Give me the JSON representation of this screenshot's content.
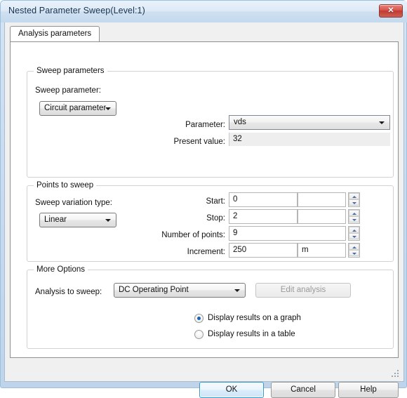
{
  "window": {
    "title": "Nested Parameter Sweep(Level:1)",
    "close_label": "✕",
    "close_icon": "close-icon",
    "accent_color": "#2f9bd4",
    "titlebar_color": "#cfe0f0"
  },
  "tabs": [
    {
      "label": "Analysis parameters",
      "selected": true
    }
  ],
  "sweep_parameters": {
    "group_title": "Sweep parameters",
    "sweep_parameter_label": "Sweep parameter:",
    "sweep_parameter_value": "Circuit parameter",
    "parameter_label": "Parameter:",
    "parameter_value": "vds",
    "present_value_label": "Present value:",
    "present_value": "32"
  },
  "points_to_sweep": {
    "group_title": "Points to sweep",
    "variation_type_label": "Sweep variation type:",
    "variation_type_value": "Linear",
    "rows": [
      {
        "label": "Start:",
        "value": "0",
        "unit": ""
      },
      {
        "label": "Stop:",
        "value": "2",
        "unit": ""
      },
      {
        "label": "Number of points:",
        "value": "9",
        "unit": null
      },
      {
        "label": "Increment:",
        "value": "250",
        "unit": "m"
      }
    ]
  },
  "more_options": {
    "group_title": "More Options",
    "analysis_to_sweep_label": "Analysis to sweep:",
    "analysis_to_sweep_value": "DC Operating Point",
    "edit_analysis_label": "Edit analysis",
    "edit_analysis_enabled": false,
    "radios": [
      {
        "label": "Display results on a graph",
        "checked": true
      },
      {
        "label": "Display results in a table",
        "checked": false
      }
    ]
  },
  "footer": {
    "ok_label": "OK",
    "cancel_label": "Cancel",
    "help_label": "Help"
  }
}
